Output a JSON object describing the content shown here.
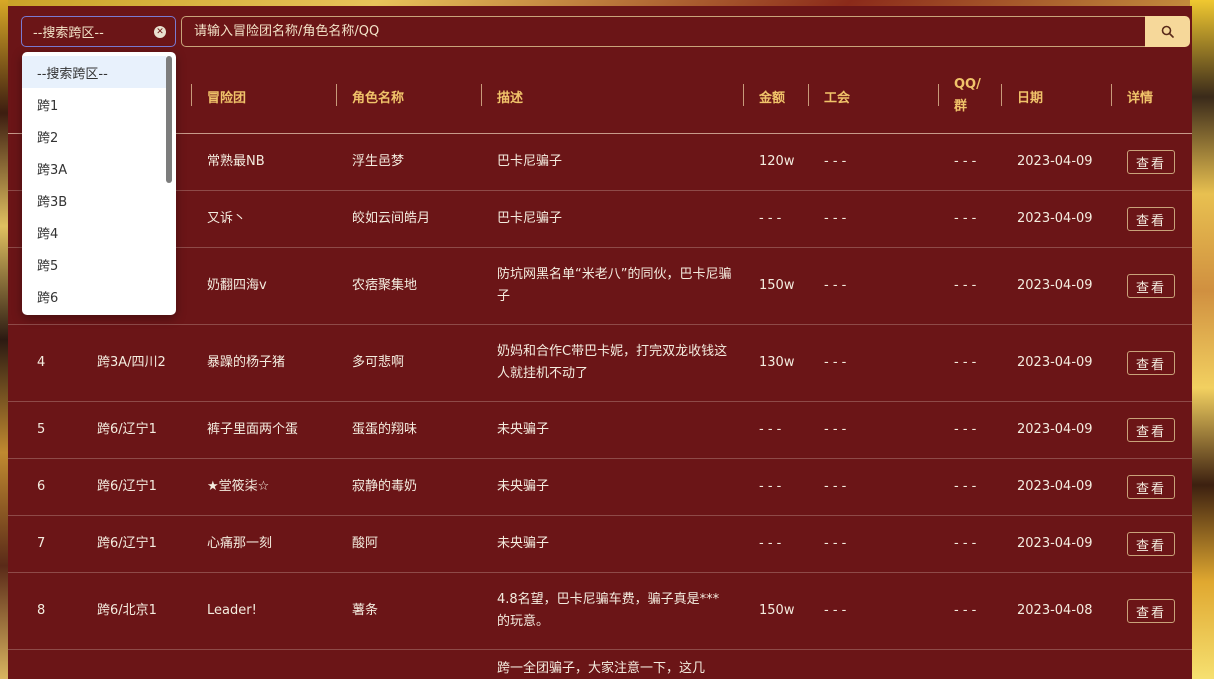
{
  "search": {
    "select_value": "--搜索跨区--",
    "input_placeholder": "请输入冒险团名称/角色名称/QQ"
  },
  "table": {
    "headers": {
      "idx": "",
      "region": "",
      "guild": "冒险团",
      "role": "角色名称",
      "desc": "描述",
      "amount": "金额",
      "union": "工会",
      "qq": "QQ/群",
      "date": "日期",
      "detail": "详情"
    },
    "view_label": "查看",
    "rows": [
      {
        "idx": "",
        "region": "",
        "guild": "常熟最NB",
        "role": "浮生邑梦",
        "desc": "巴卡尼骗子",
        "amount": "120w",
        "union": "- - -",
        "qq": "- - -",
        "date": "2023-04-09"
      },
      {
        "idx": "",
        "region": "",
        "guild": "又诉丶",
        "role": "皎如云间皓月",
        "desc": "巴卡尼骗子",
        "amount": "- - -",
        "union": "- - -",
        "qq": "- - -",
        "date": "2023-04-09"
      },
      {
        "idx": "",
        "region": "",
        "guild": "奶翻四海v",
        "role": "农痞聚集地",
        "desc": "防坑网黑名单“米老八”的同伙，巴卡尼骗子",
        "amount": "150w",
        "union": "- - -",
        "qq": "- - -",
        "date": "2023-04-09"
      },
      {
        "idx": "4",
        "region": "跨3A/四川2",
        "guild": "暴躁的杨子猪",
        "role": "多可悲啊",
        "desc": "奶妈和合作C带巴卡妮，打完双龙收钱这人就挂机不动了",
        "amount": "130w",
        "union": "- - -",
        "qq": "- - -",
        "date": "2023-04-09"
      },
      {
        "idx": "5",
        "region": "跨6/辽宁1",
        "guild": "裤子里面两个蛋",
        "role": "蛋蛋的翔味",
        "desc": "未央骗子",
        "amount": "- - -",
        "union": "- - -",
        "qq": "- - -",
        "date": "2023-04-09"
      },
      {
        "idx": "6",
        "region": "跨6/辽宁1",
        "guild": "★堂筱柒☆",
        "role": "寂静的毒奶",
        "desc": "未央骗子",
        "amount": "- - -",
        "union": "- - -",
        "qq": "- - -",
        "date": "2023-04-09"
      },
      {
        "idx": "7",
        "region": "跨6/辽宁1",
        "guild": "心痛那一刻",
        "role": "酸阿",
        "desc": "未央骗子",
        "amount": "- - -",
        "union": "- - -",
        "qq": "- - -",
        "date": "2023-04-09"
      },
      {
        "idx": "8",
        "region": "跨6/北京1",
        "guild": "Leader!",
        "role": "薯条",
        "desc": "4.8名望，巴卡尼骗车费，骗子真是***的玩意。",
        "amount": "150w",
        "union": "- - -",
        "qq": "- - -",
        "date": "2023-04-08"
      },
      {
        "idx": "",
        "region": "",
        "guild": "",
        "role": "",
        "desc": "跨一全团骗子，大家注意一下，这几",
        "amount": "",
        "union": "",
        "qq": "",
        "date": ""
      }
    ]
  },
  "dropdown": {
    "options": [
      "--搜索跨区--",
      "跨1",
      "跨2",
      "跨3A",
      "跨3B",
      "跨4",
      "跨5",
      "跨6"
    ]
  },
  "colors": {
    "panel": "#6b1517",
    "header_text": "#f0c36a",
    "search_button": "#f6d89a"
  }
}
